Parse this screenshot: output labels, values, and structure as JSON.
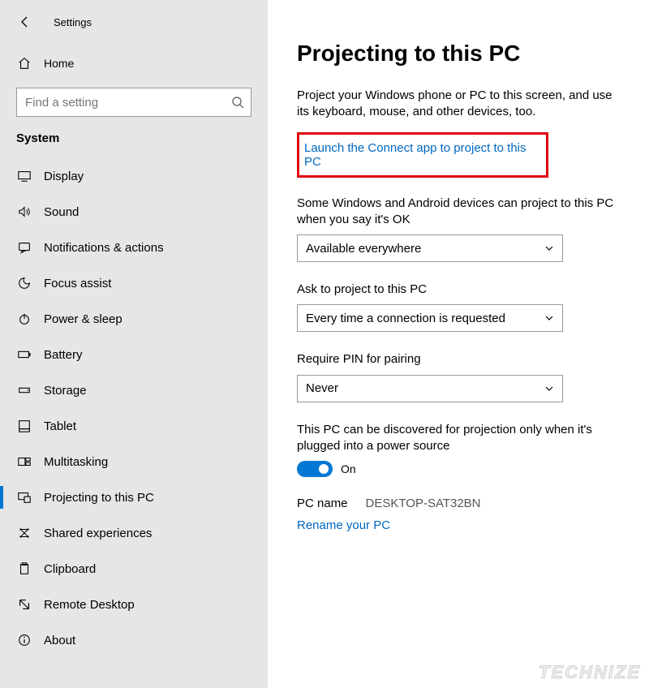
{
  "titlebar": {
    "title": "Settings"
  },
  "sidebar": {
    "home": "Home",
    "search_placeholder": "Find a setting",
    "category": "System",
    "items": [
      {
        "label": "Display",
        "icon": "display-icon"
      },
      {
        "label": "Sound",
        "icon": "sound-icon"
      },
      {
        "label": "Notifications & actions",
        "icon": "notifications-icon"
      },
      {
        "label": "Focus assist",
        "icon": "focus-assist-icon"
      },
      {
        "label": "Power & sleep",
        "icon": "power-icon"
      },
      {
        "label": "Battery",
        "icon": "battery-icon"
      },
      {
        "label": "Storage",
        "icon": "storage-icon"
      },
      {
        "label": "Tablet",
        "icon": "tablet-icon"
      },
      {
        "label": "Multitasking",
        "icon": "multitasking-icon"
      },
      {
        "label": "Projecting to this PC",
        "icon": "projecting-icon"
      },
      {
        "label": "Shared experiences",
        "icon": "shared-icon"
      },
      {
        "label": "Clipboard",
        "icon": "clipboard-icon"
      },
      {
        "label": "Remote Desktop",
        "icon": "remote-icon"
      },
      {
        "label": "About",
        "icon": "about-icon"
      }
    ],
    "active_index": 9
  },
  "main": {
    "heading": "Projecting to this PC",
    "description": "Project your Windows phone or PC to this screen, and use its keyboard, mouse, and other devices, too.",
    "launch_link": "Launch the Connect app to project to this PC",
    "field1": {
      "label": "Some Windows and Android devices can project to this PC when you say it's OK",
      "value": "Available everywhere"
    },
    "field2": {
      "label": "Ask to project to this PC",
      "value": "Every time a connection is requested"
    },
    "field3": {
      "label": "Require PIN for pairing",
      "value": "Never"
    },
    "discover": {
      "label": "This PC can be discovered for projection only when it's plugged into a power source",
      "state": "On"
    },
    "pcname": {
      "label": "PC name",
      "value": "DESKTOP-SAT32BN"
    },
    "rename_link": "Rename your PC"
  },
  "watermark": "TECHNIZE"
}
